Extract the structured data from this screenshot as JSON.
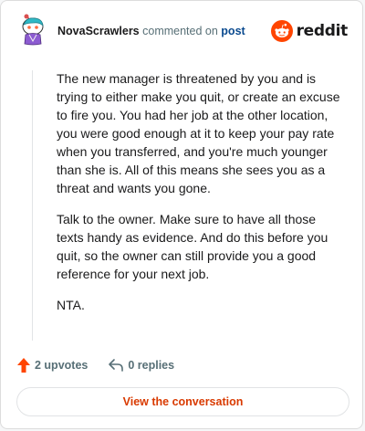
{
  "header": {
    "username": "NovaScrawlers",
    "action": "commented on",
    "post_link": "post",
    "brand_word": "reddit",
    "avatar_icon": "snoo-avatar-icon",
    "brand_icon": "reddit-logo-icon"
  },
  "comment": {
    "paragraphs": [
      "The new manager is threatened by you and is trying to either make you quit, or create an excuse to fire you. You had her job at the other location, you were good enough at it to keep your pay rate when you transferred, and you're much younger than she is. All of this means she sees you as a threat and wants you gone.",
      "Talk to the owner. Make sure to have all those texts handy as evidence. And do this before you quit, so the owner can still provide you a good reference for your next job.",
      "NTA."
    ]
  },
  "footer": {
    "upvotes": "2 upvotes",
    "replies": "0 replies",
    "upvote_icon": "upvote-arrow-icon",
    "reply_icon": "reply-icon"
  },
  "cta": {
    "label": "View the conversation"
  },
  "colors": {
    "brand": "#ff4500",
    "cta_text": "#d93a00",
    "link": "#0a4a8f",
    "muted": "#576f76",
    "thread_line": "#e2e4e6"
  }
}
